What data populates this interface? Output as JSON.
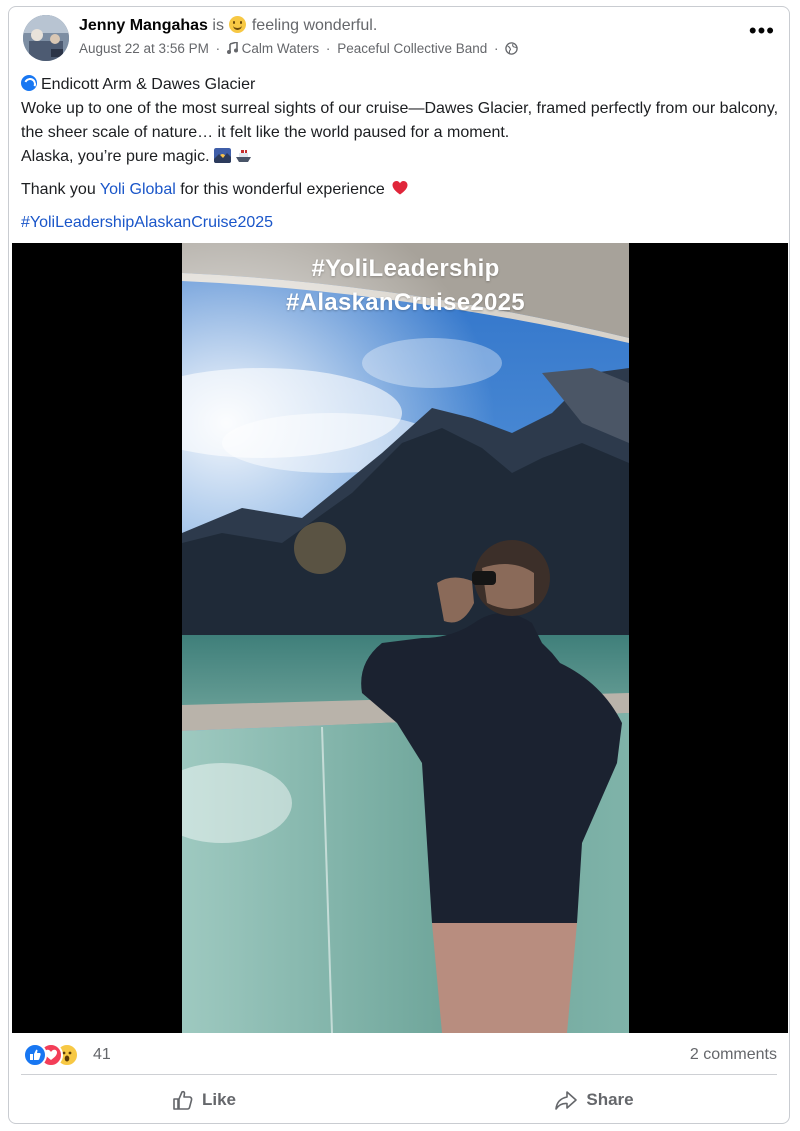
{
  "post": {
    "author": "Jenny Mangahas",
    "is_text": "is",
    "feeling": "feeling wonderful.",
    "date": "August 22 at 3:56 PM",
    "sep": "·",
    "music_title": "Calm Waters",
    "music_artist": "Peaceful Collective Band",
    "more_label": "•••",
    "location": "Endicott Arm & Dawes Glacier",
    "body_line1": "Woke up to one of the most surreal sights of our cruise—Dawes Glacier, framed perfectly from our balcony, the sheer scale of nature… it felt like the world paused for a moment.",
    "body_line2": "Alaska, you’re pure magic.",
    "thanks_prefix": "Thank you",
    "thanks_link": "Yoli Global",
    "thanks_suffix": "for this wonderful experience",
    "hashtag": "#YoliLeadershipAlaskanCruise2025"
  },
  "media": {
    "overlay_line1": "#YoliLeadership",
    "overlay_line2": "#AlaskanCruise2025"
  },
  "footer": {
    "reaction_count": "41",
    "comments": "2 comments",
    "like_label": "Like",
    "share_label": "Share"
  },
  "icons": {
    "reactions": [
      "like-icon",
      "love-icon",
      "wow-icon"
    ],
    "music": "music-note-icon",
    "privacy": "globe-icon"
  }
}
